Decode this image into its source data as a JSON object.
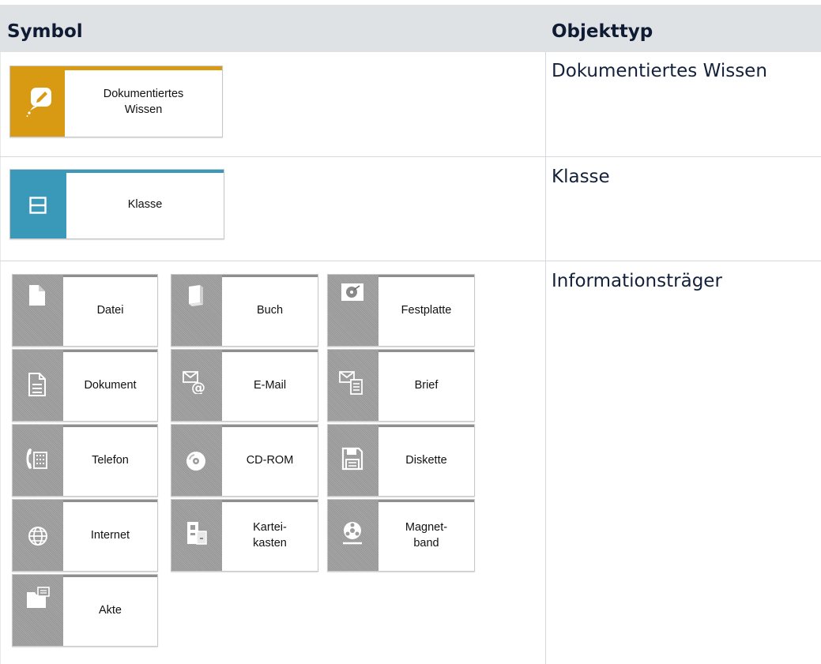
{
  "header": {
    "col_symbol": "Symbol",
    "col_objekttyp": "Objekttyp"
  },
  "rows": [
    {
      "objekttyp": "Dokumentiertes Wissen"
    },
    {
      "objekttyp": "Klasse"
    },
    {
      "objekttyp": "Informationsträger"
    }
  ],
  "symbols": {
    "dokumentiertes_wissen": {
      "label": "Dokumentiertes\nWissen",
      "color": "#d89a12",
      "icon": "pencil-bubble-icon"
    },
    "klasse": {
      "label": "Klasse",
      "color": "#3a98b9",
      "icon": "class-box-icon"
    },
    "datei": {
      "label": "Datei",
      "icon": "file-icon"
    },
    "buch": {
      "label": "Buch",
      "icon": "book-icon"
    },
    "festplatte": {
      "label": "Festplatte",
      "icon": "hard-disk-icon"
    },
    "dokument": {
      "label": "Dokument",
      "icon": "document-icon"
    },
    "email": {
      "label": "E-Mail",
      "icon": "email-icon"
    },
    "brief": {
      "label": "Brief",
      "icon": "letter-icon"
    },
    "telefon": {
      "label": "Telefon",
      "icon": "phone-icon"
    },
    "cdrom": {
      "label": "CD-ROM",
      "icon": "cd-icon"
    },
    "diskette": {
      "label": "Diskette",
      "icon": "floppy-icon"
    },
    "internet": {
      "label": "Internet",
      "icon": "globe-icon"
    },
    "karteikasten": {
      "label": "Kartei-\nkasten",
      "icon": "card-index-icon"
    },
    "magnetband": {
      "label": "Magnet-\nband",
      "icon": "tape-icon"
    },
    "akte": {
      "label": "Akte",
      "icon": "folder-icon"
    }
  }
}
